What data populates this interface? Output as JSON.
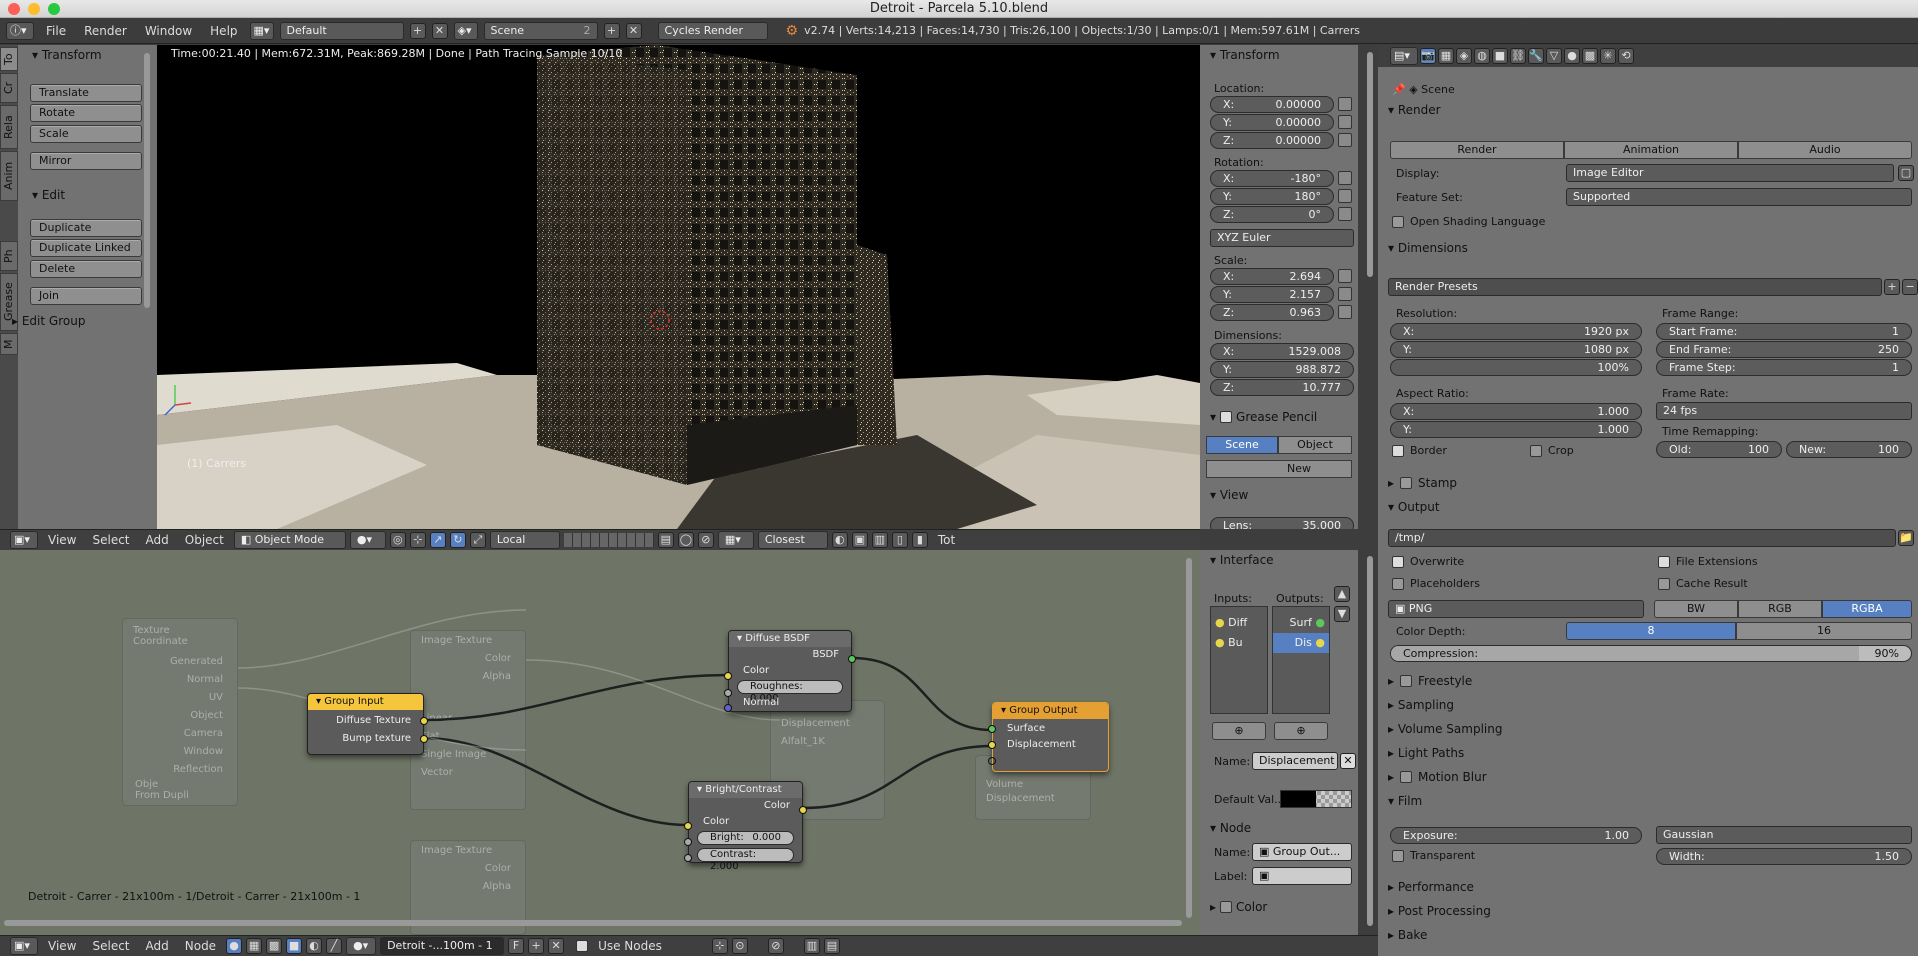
{
  "window_title": "Detroit - Parcela 5.10.blend",
  "top_menu": [
    "File",
    "Render",
    "Window",
    "Help"
  ],
  "screen_layout": "Default",
  "scene_field": "Scene",
  "scene_users": "2",
  "render_engine": "Cycles Render",
  "stats": "v2.74 | Verts:14,213 | Faces:14,730 | Tris:26,100 | Objects:1/30 | Lamps:0/1 | Mem:597.61M | Carrers",
  "tool_tabs": [
    "To",
    "Cr",
    "Rela",
    "Anim",
    "Ph",
    "Grease",
    "M"
  ],
  "tool_panel": {
    "transform_title": "Transform",
    "transform_buttons": [
      "Translate",
      "Rotate",
      "Scale",
      "Mirror"
    ],
    "edit_title": "Edit",
    "edit_buttons": [
      "Duplicate",
      "Duplicate Linked",
      "Delete",
      "Join"
    ],
    "edit_group": "Edit Group"
  },
  "viewport": {
    "render_info": "Time:00:21.40 | Mem:672.31M, Peak:869.28M | Done | Path Tracing Sample 10/10",
    "object_label": "(1) Carrers"
  },
  "n_panel": {
    "transform": "Transform",
    "location": "Location:",
    "loc": [
      [
        "X:",
        "0.00000"
      ],
      [
        "Y:",
        "0.00000"
      ],
      [
        "Z:",
        "0.00000"
      ]
    ],
    "rotation": "Rotation:",
    "rot": [
      [
        "X:",
        "-180°"
      ],
      [
        "Y:",
        "180°"
      ],
      [
        "Z:",
        "0°"
      ]
    ],
    "rot_mode": "XYZ Euler",
    "scale": "Scale:",
    "scl": [
      [
        "X:",
        "2.694"
      ],
      [
        "Y:",
        "2.157"
      ],
      [
        "Z:",
        "0.963"
      ]
    ],
    "dimensions": "Dimensions:",
    "dim": [
      [
        "X:",
        "1529.008"
      ],
      [
        "Y:",
        "988.872"
      ],
      [
        "Z:",
        "10.777"
      ]
    ],
    "grease_pencil": "Grease Pencil",
    "gp_scene": "Scene",
    "gp_object": "Object",
    "gp_new": "New",
    "view": "View",
    "lens": "Lens:",
    "lens_val": "35.000"
  },
  "view3d_header": {
    "menus": [
      "View",
      "Select",
      "Add",
      "Object"
    ],
    "mode": "Object Mode",
    "orientation": "Local",
    "snap": "Closest",
    "tot": "Tot"
  },
  "node_editor": {
    "footer_text": "Detroit - Carrer - 21x100m - 1/Detroit - Carrer - 21x100m - 1",
    "group_input": {
      "title": "Group Input",
      "outputs": [
        "Diffuse Texture",
        "Bump texture"
      ]
    },
    "diffuse": {
      "title": "Diffuse BSDF",
      "output": "BSDF",
      "inputs": [
        "Color",
        "Normal"
      ],
      "rough": "Roughnes: 0.000"
    },
    "bright": {
      "title": "Bright/Contrast",
      "output": "Color",
      "input": "Color",
      "bright": "Bright:",
      "bright_val": "0.000",
      "contrast": "Contrast: 2.000"
    },
    "group_output": {
      "title": "Group Output",
      "inputs": [
        "Surface",
        "Displacement"
      ]
    },
    "ghost_texcoord": {
      "title": "Texture Coordinate",
      "items": [
        "Generated",
        "Normal",
        "UV",
        "Object",
        "Camera",
        "Window",
        "Reflection"
      ],
      "obj": "Obje",
      "from_dupli": "From Dupli"
    },
    "ghost_image": {
      "title": "Image Texture",
      "items": [
        "Color",
        "Alpha"
      ],
      "single": "Single Image",
      "vector": "Vector",
      "flat": "Flat",
      "linear": "Linear"
    },
    "ghost_image2": {
      "title": "Image Texture",
      "items": [
        "Color",
        "Alpha"
      ]
    },
    "ghost_misc": [
      "Displacement",
      "Alfalt_1K",
      "Volume",
      "Displacement"
    ]
  },
  "interface_panel": {
    "title": "Interface",
    "inputs": "Inputs:",
    "outputs": "Outputs:",
    "in_items": [
      "Diff",
      "Bu"
    ],
    "out_items": [
      "Surf",
      "Dis"
    ],
    "name_label": "Name:",
    "name_val": "Displacement",
    "default_val": "Default Val...",
    "node_title": "Node",
    "node_name_label": "Name:",
    "node_name": "Group Out...",
    "node_label": "Label:",
    "color": "Color"
  },
  "node_header": {
    "menus": [
      "View",
      "Select",
      "Add",
      "Node"
    ],
    "tree": "Detroit -...100m - 1",
    "f": "F",
    "use_nodes": "Use Nodes"
  },
  "properties": {
    "scene": "Scene",
    "render": "Render",
    "render_btns": [
      "Render",
      "Animation",
      "Audio"
    ],
    "display_label": "Display:",
    "display": "Image Editor",
    "feature_label": "Feature Set:",
    "feature": "Supported",
    "osl": "Open Shading Language",
    "dimensions": "Dimensions",
    "presets": "Render Presets",
    "resolution": "Resolution:",
    "res": [
      [
        "X:",
        "1920 px"
      ],
      [
        "Y:",
        "1080 px"
      ],
      [
        "",
        "100%"
      ]
    ],
    "frame_range": "Frame Range:",
    "frames": [
      [
        "Start Frame:",
        "1"
      ],
      [
        "End Frame:",
        "250"
      ],
      [
        "Frame Step:",
        "1"
      ]
    ],
    "aspect": "Aspect Ratio:",
    "asp": [
      [
        "X:",
        "1.000"
      ],
      [
        "Y:",
        "1.000"
      ]
    ],
    "frame_rate": "Frame Rate:",
    "fps": "24 fps",
    "time_remap": "Time Remapping:",
    "old": "Old:",
    "old_val": "100",
    "new": "New:",
    "new_val": "100",
    "border": "Border",
    "crop": "Crop",
    "stamp": "Stamp",
    "output": "Output",
    "path": "/tmp/",
    "overwrite": "Overwrite",
    "file_ext": "File Extensions",
    "placeholders": "Placeholders",
    "cache": "Cache Result",
    "format": "PNG",
    "bw": "BW",
    "rgb": "RGB",
    "rgba": "RGBA",
    "color_depth": "Color Depth:",
    "depth8": "8",
    "depth16": "16",
    "compression": "Compression:",
    "compression_val": "90%",
    "compression_level": 0.9,
    "freestyle": "Freestyle",
    "sampling": "Sampling",
    "volume": "Volume Sampling",
    "light_paths": "Light Paths",
    "motion_blur": "Motion Blur",
    "film": "Film",
    "exposure": "Exposure:",
    "exposure_val": "1.00",
    "filter": "Gaussian",
    "transparent": "Transparent",
    "width": "Width:",
    "width_val": "1.50",
    "performance": "Performance",
    "post": "Post Processing",
    "bake": "Bake"
  },
  "colors": {
    "accent": "#5680c2",
    "node_yellow": "#f5c53c",
    "node_orange": "#e5a033"
  }
}
